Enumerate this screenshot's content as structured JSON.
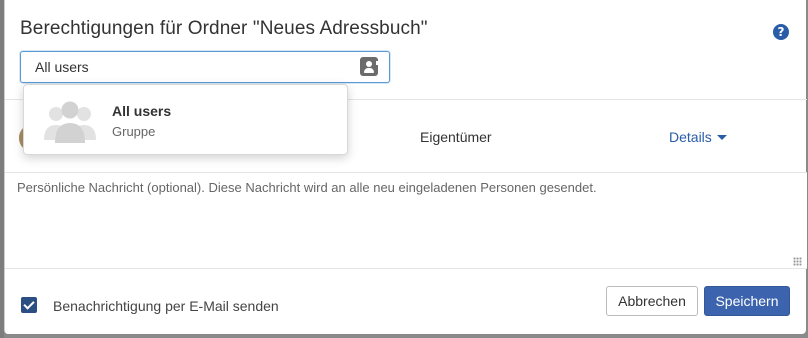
{
  "dialog": {
    "title": "Berechtigungen für Ordner \"Neues Adressbuch\"",
    "help_icon": "question-circle-icon"
  },
  "search": {
    "value": "All users",
    "placeholder": "",
    "addressbook_icon": "address-book-icon"
  },
  "autocomplete": {
    "items": [
      {
        "name": "All users",
        "type": "Gruppe",
        "icon": "group-avatar-icon"
      }
    ]
  },
  "permissions": {
    "rows": [
      {
        "role": "Eigentümer",
        "details_label": "Details",
        "avatar": "user-avatar"
      }
    ]
  },
  "message": {
    "placeholder": "Persönliche Nachricht (optional). Diese Nachricht wird an alle neu eingeladenen Personen gesendet.",
    "value": ""
  },
  "footer": {
    "notify_label": "Benachrichtigung per E-Mail senden",
    "notify_checked": true,
    "cancel_label": "Abbrechen",
    "save_label": "Speichern"
  },
  "colors": {
    "primary": "#3c63ad",
    "link": "#2a5da8",
    "checkbox": "#2b4f82",
    "backdrop": "#8a8a8a"
  }
}
